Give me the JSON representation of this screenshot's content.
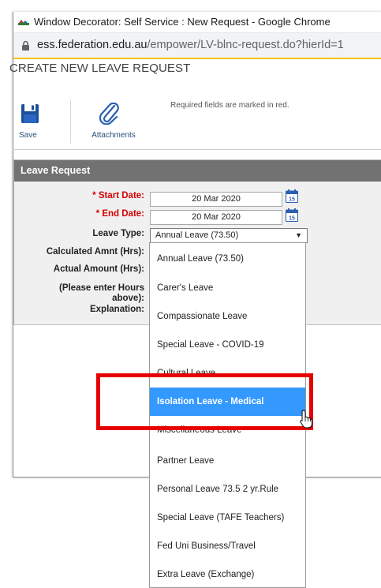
{
  "window": {
    "title": "Window Decorator: Self Service : New Request - Google Chrome",
    "url_host": "ess.federation.edu.au",
    "url_path": "/empower/LV-blnc-request.do?hierId=1",
    "accent_color": "#f4c40f"
  },
  "page": {
    "title": "CREATE NEW LEAVE REQUEST",
    "required_note": "Required fields are marked in red."
  },
  "toolbar": {
    "save_label": "Save",
    "save_icon": "floppy-disk-icon",
    "attachments_label": "Attachments",
    "attachments_icon": "paperclip-icon"
  },
  "form": {
    "section_title": "Leave Request",
    "start_date_label": "* Start Date:",
    "start_date_value": "20 Mar 2020",
    "end_date_label": "* End Date:",
    "end_date_value": "20 Mar 2020",
    "leave_type_label": "Leave Type:",
    "leave_type_value": "Annual Leave (73.50)",
    "calc_amount_label": "Calculated Amnt (Hrs):",
    "actual_amount_label": "Actual Amount (Hrs):",
    "hours_note_line1": "(Please enter Hours",
    "hours_note_line2": "above):",
    "explanation_label": "Explanation:",
    "required_color": "#d60000",
    "header_color": "#727272"
  },
  "dropdown": {
    "selected_index": 5,
    "highlight_color": "#3399ff",
    "options": [
      "Annual Leave (73.50)",
      "Carer's Leave",
      "Compassionate Leave",
      "Special Leave - COVID-19",
      "Cultural Leave",
      "Isolation Leave - Medical",
      "Miscellaneous Leave",
      "Partner Leave",
      "Personal Leave 73.5 2 yr.Rule",
      "Special Leave (TAFE Teachers)",
      "Fed Uni Business/Travel",
      "Extra Leave (Exchange)"
    ]
  },
  "annotation": {
    "highlight_box_color": "#e60000"
  }
}
